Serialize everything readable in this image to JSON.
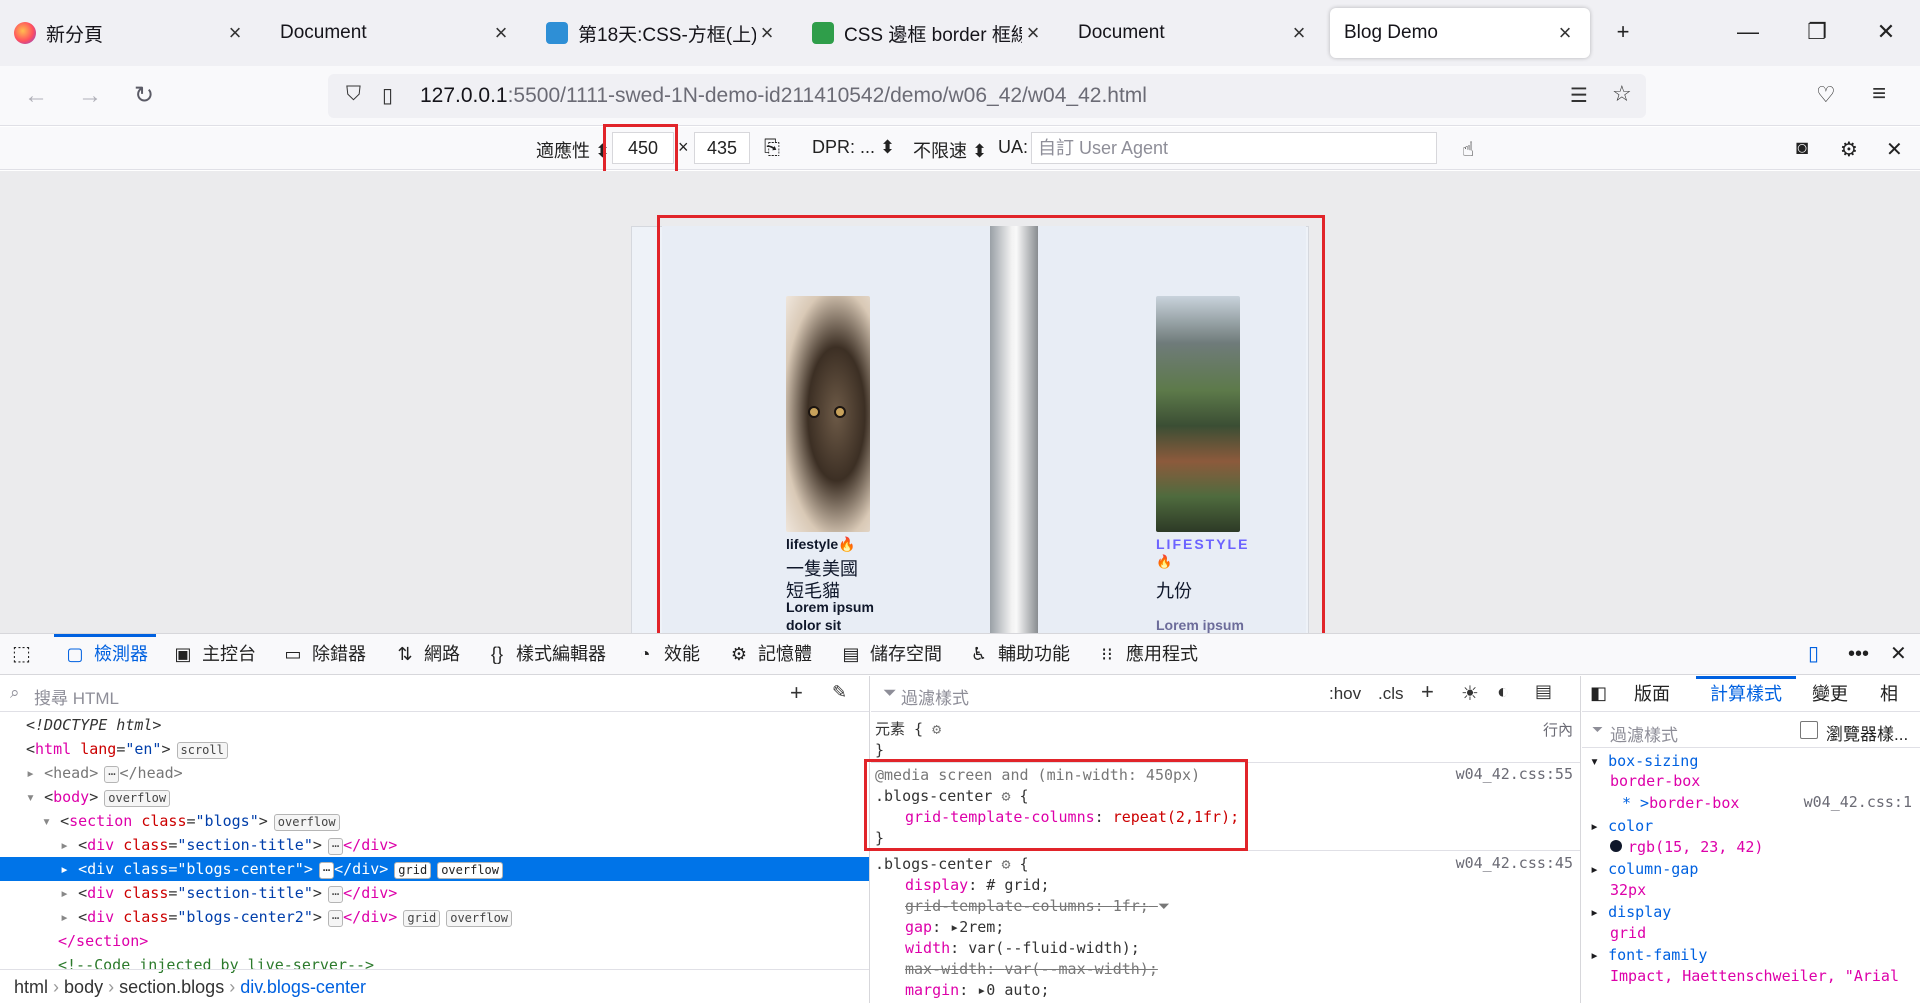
{
  "browser": {
    "tabs": [
      {
        "title": "新分頁",
        "favicon": "firefox-icon"
      },
      {
        "title": "Document",
        "favicon": ""
      },
      {
        "title": "第18天:CSS-方框(上) -",
        "favicon": "blog-site-icon"
      },
      {
        "title": "CSS 邊框 border 框線",
        "favicon": "green-book-icon"
      },
      {
        "title": "Document",
        "favicon": ""
      },
      {
        "title": "Blog Demo",
        "favicon": ""
      }
    ],
    "active_tab": 5,
    "url_host": "127.0.0.1",
    "url_path": ":5500/1111-swed-1N-demo-id211410542/demo/w06_42/w04_42.html"
  },
  "rdm": {
    "device_label": "適應性",
    "width": "450",
    "times": "×",
    "height": "435",
    "dpr_label": "DPR: ...",
    "throttle_label": "不限速",
    "ua_label": "UA:",
    "ua_placeholder": "自訂 User Agent"
  },
  "viewport": {
    "blog1": {
      "category": "lifestyle",
      "title_line1": "一隻美國",
      "title_line2": "短毛貓",
      "text_line1": "Lorem ipsum",
      "text_line2": "dolor sit"
    },
    "blog2": {
      "category": "LIFESTYLE",
      "title": "九份",
      "text_line1": "Lorem ipsum"
    }
  },
  "devtools": {
    "tabs": [
      {
        "label": "檢測器",
        "icon": "inspector-icon"
      },
      {
        "label": "主控台",
        "icon": "console-icon"
      },
      {
        "label": "除錯器",
        "icon": "debugger-icon"
      },
      {
        "label": "網路",
        "icon": "network-icon"
      },
      {
        "label": "樣式編輯器",
        "icon": "style-editor-icon"
      },
      {
        "label": "效能",
        "icon": "performance-icon"
      },
      {
        "label": "記憶體",
        "icon": "memory-icon"
      },
      {
        "label": "儲存空間",
        "icon": "storage-icon"
      },
      {
        "label": "輔助功能",
        "icon": "accessibility-icon"
      },
      {
        "label": "應用程式",
        "icon": "application-icon"
      }
    ],
    "search_html_placeholder": "搜尋 HTML",
    "tree": [
      {
        "text_tag": "<!DOCTYPE html>",
        "badges": []
      },
      {
        "tag": "html",
        "attr": "lang",
        "val": "\"en\"",
        "badges": [
          "scroll"
        ]
      },
      {
        "text_tag": "<head>",
        "close": "</head>",
        "badges": []
      },
      {
        "tag": "body",
        "badges": [
          "overflow"
        ]
      },
      {
        "tag": "section",
        "attr": "class",
        "val": "\"blogs\"",
        "badges": [
          "overflow"
        ]
      },
      {
        "tag": "div",
        "attr": "class",
        "val": "\"section-title\"",
        "close": "</div>",
        "badges": []
      },
      {
        "tag": "div",
        "attr": "class",
        "val": "\"blogs-center\"",
        "close": "</div>",
        "badges": [
          "grid",
          "overflow"
        ]
      },
      {
        "tag": "div",
        "attr": "class",
        "val": "\"section-title\"",
        "close": "</div>",
        "badges": []
      },
      {
        "tag": "div",
        "attr": "class",
        "val": "\"blogs-center2\"",
        "close": "</div>",
        "badges": [
          "grid",
          "overflow"
        ]
      },
      {
        "text_tag": "</section>",
        "badges": []
      },
      {
        "text_tag": "<!--Code injected by live-server-->",
        "badges": []
      }
    ],
    "breadcrumbs": [
      "html",
      "body",
      "section.blogs",
      "div.blogs-center"
    ],
    "rules": {
      "filter_placeholder": "過濾樣式",
      "hov": ":hov",
      "cls": ".cls",
      "element_selector": "元素",
      "inline_label": "行內",
      "media": "@media screen and (min-width: 450px)",
      "selector1": ".blogs-center",
      "src1": "w04_42.css:55",
      "decl1_prop": "grid-template-columns",
      "decl1_val": "repeat(2,1fr);",
      "selector2": ".blogs-center",
      "src2": "w04_42.css:45",
      "decls2": [
        {
          "prop": "display",
          "val": "grid;",
          "struck": false
        },
        {
          "prop": "grid-template-columns",
          "val": "1fr;",
          "struck": true
        },
        {
          "prop": "gap",
          "val": "2rem;",
          "struck": false
        },
        {
          "prop": "width",
          "val": "var(--fluid-width);",
          "struck": false
        },
        {
          "prop": "max-width",
          "val": "var(--max-width);",
          "struck": true
        },
        {
          "prop": "margin",
          "val": "0 auto;",
          "struck": false
        }
      ]
    },
    "computed": {
      "tabs": [
        "版面",
        "計算樣式",
        "變更",
        "相"
      ],
      "filter_placeholder": "過濾樣式",
      "browser_styles_label": "瀏覽器樣...",
      "props": [
        {
          "prop": "box-sizing",
          "val": "border-box",
          "sub": "border-box",
          "src": "w04_42.css:1"
        },
        {
          "prop": "color",
          "val": "rgb(15, 23, 42)"
        },
        {
          "prop": "column-gap",
          "val": "32px"
        },
        {
          "prop": "display",
          "val": "grid"
        },
        {
          "prop": "font-family",
          "val": "Impact, Haettenschweiler, \"Arial"
        }
      ]
    }
  }
}
